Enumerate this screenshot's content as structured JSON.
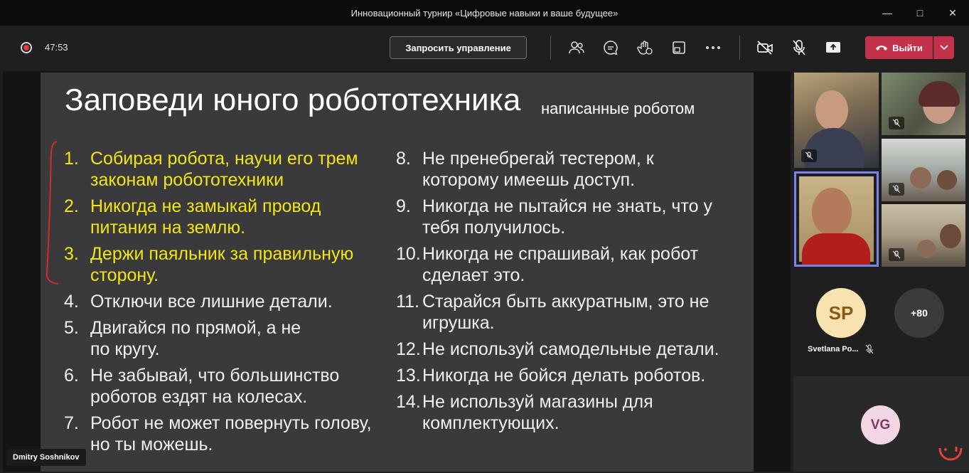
{
  "window": {
    "title": "Инновационный турнир «Цифровые навыки и ваше будущее»"
  },
  "toolbar": {
    "timer": "47:53",
    "request_control": "Запросить управление",
    "leave_label": "Выйти"
  },
  "slide": {
    "title": "Заповеди юного робототехника",
    "subtitle": "написанные роботом",
    "left_items": [
      {
        "num": "1.",
        "text": "Собирая робота, научи его трем законам робототехники"
      },
      {
        "num": "2.",
        "text": "Никогда не замыкай провод питания на землю."
      },
      {
        "num": "3.",
        "text": "Держи паяльник за правильную сторону."
      },
      {
        "num": "4.",
        "text": "Отключи все лишние детали."
      },
      {
        "num": "5.",
        "text": "Двигайся по прямой, а не по кругу."
      },
      {
        "num": "6.",
        "text": "Не забывай, что большинство роботов ездят на колесах."
      },
      {
        "num": "7.",
        "text": "Робот не может повернуть голову, но ты можешь."
      }
    ],
    "right_items": [
      {
        "num": "8.",
        "text": "Не пренебрегай тестером, к которому имеешь доступ."
      },
      {
        "num": "9.",
        "text": "Никогда не пытайся не знать, что у тебя получилось."
      },
      {
        "num": "10.",
        "text": "Никогда не спрашивай, как робот сделает это."
      },
      {
        "num": "11.",
        "text": "Старайся быть аккуратным, это не игрушка."
      },
      {
        "num": "12.",
        "text": "Не используй самодельные детали."
      },
      {
        "num": "13.",
        "text": "Никогда не бойся делать роботов."
      },
      {
        "num": "14.",
        "text": "Не используй магазины для комплектующих."
      }
    ]
  },
  "presenter": {
    "name": "Dmitry Soshnikov"
  },
  "participants": {
    "sp_initials": "SP",
    "sp_name": "Svetlana Po...",
    "more_count": "+80",
    "vg_initials": "VG"
  },
  "colors": {
    "accent_yellow": "#f3e514",
    "leave_red": "#c4314b",
    "active_border": "#7b83eb"
  }
}
